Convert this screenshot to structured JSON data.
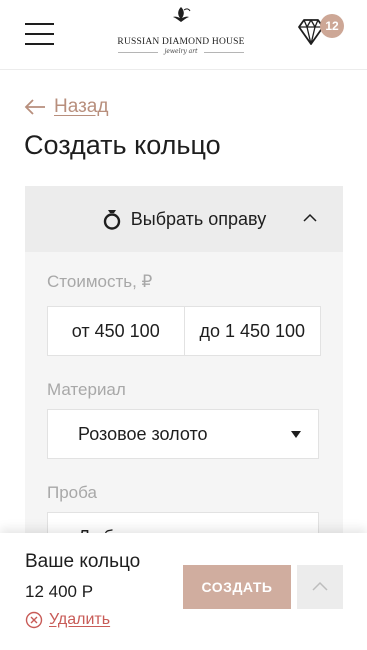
{
  "header": {
    "logo_name": "RUSSIAN DIAMOND HOUSE",
    "logo_sub": "jewelry art",
    "cart_count": "12"
  },
  "nav": {
    "back_label": "Назад"
  },
  "page": {
    "title": "Создать кольцо"
  },
  "panel": {
    "heading": "Выбрать оправу",
    "price_label": "Стоимость, ₽",
    "price_from": "от 450 100",
    "price_to": "до 1 450 100",
    "material_label": "Материал",
    "material_value": "Розовое золото",
    "probe_label": "Проба",
    "probe_value": "Любая"
  },
  "summary": {
    "title": "Ваше кольцо",
    "price": "12 400 Р",
    "remove_label": "Удалить",
    "create_label": "СОЗДАТЬ"
  },
  "colors": {
    "accent": "#b88f7d",
    "button": "#d0ad9f",
    "danger": "#c85b57",
    "panel_bg": "#f5f5f5"
  }
}
